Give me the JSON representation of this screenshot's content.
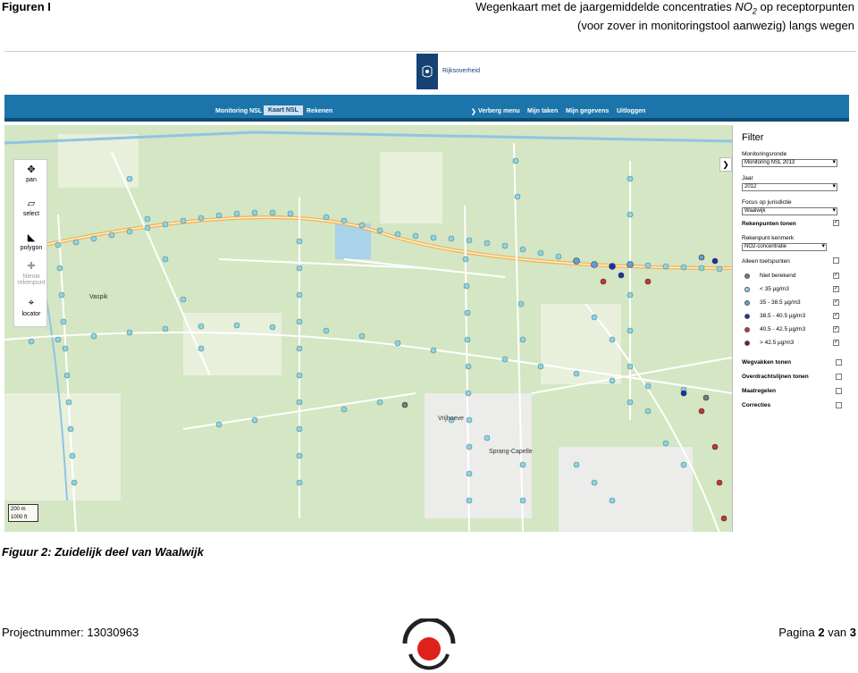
{
  "header": {
    "label": "Figuren I",
    "title_line1_pre": "Wegenkaart met de jaargemiddelde concentraties ",
    "title_no2_n": "NO",
    "title_no2_sub": "2",
    "title_line1_post": " op receptorpunten",
    "title_line2": "(voor zover in monitoringstool aanwezig) langs wegen"
  },
  "app": {
    "logo_text": "Rijksoverheid",
    "tabs": [
      "Monitoring NSL",
      "Kaart NSL",
      "Rekenen"
    ],
    "nav_right": [
      "Verberg menu",
      "Mijn taken",
      "Mijn gegevens",
      "Uitloggen"
    ],
    "nav_arrow": "❯"
  },
  "tools": {
    "items": [
      {
        "label": "pan",
        "icon": "✥"
      },
      {
        "label": "select",
        "icon": "▱"
      },
      {
        "label": "polygon",
        "icon": "◣"
      },
      {
        "label": "Nieuw rekenpunt",
        "icon": "✚"
      },
      {
        "label": "locator",
        "icon": "⌖"
      }
    ]
  },
  "map_labels": {
    "places": [
      "Vrijhoeve",
      "Sprang-Capelle",
      "Vaspik"
    ],
    "scale": [
      "200 m",
      "1000 ft"
    ]
  },
  "filter": {
    "title": "Filter",
    "monitoringsronde_label": "Monitoringsronde",
    "monitoringsronde_value": "Monitoring NSL 2013",
    "jaar_label": "Jaar",
    "jaar_value": "2012",
    "focus_label": "Focus op jurisdictie",
    "focus_value": "Waalwijk",
    "rekenpunten_tonen": "Rekenpunten tonen",
    "kenmerk_label": "Rekenpunt kenmerk",
    "kenmerk_value": "NO2-concentratie",
    "alleen_toetspunten": "Alleen toetspunten",
    "legend": [
      {
        "label": "Niet berekend",
        "color": "#7a7a7a",
        "checked": true
      },
      {
        "label": "< 35 µg/m3",
        "color": "#8fd3e0",
        "checked": true
      },
      {
        "label": "35 - 38.5 µg/m3",
        "color": "#5fa0d6",
        "checked": true
      },
      {
        "label": "38.5 - 40.5 µg/m3",
        "color": "#1a2fb0",
        "checked": true
      },
      {
        "label": "40.5 - 42.5 µg/m3",
        "color": "#c9342e",
        "checked": true
      },
      {
        "label": "> 42.5 µg/m3",
        "color": "#8a1a14",
        "checked": true
      }
    ],
    "layers": [
      {
        "label": "Wegvakken tonen",
        "checked": false
      },
      {
        "label": "Overdrachtslijnen tonen",
        "checked": false
      },
      {
        "label": "Maatregelen",
        "checked": false
      },
      {
        "label": "Correcties",
        "checked": false
      }
    ]
  },
  "caption": "Figuur 2: Zuidelijk deel van Waalwijk",
  "footer": {
    "project_label": "Projectnummer: 13030963",
    "page_pre": "Pagina ",
    "page_num": "2",
    "page_mid": " van ",
    "page_total": "3"
  }
}
